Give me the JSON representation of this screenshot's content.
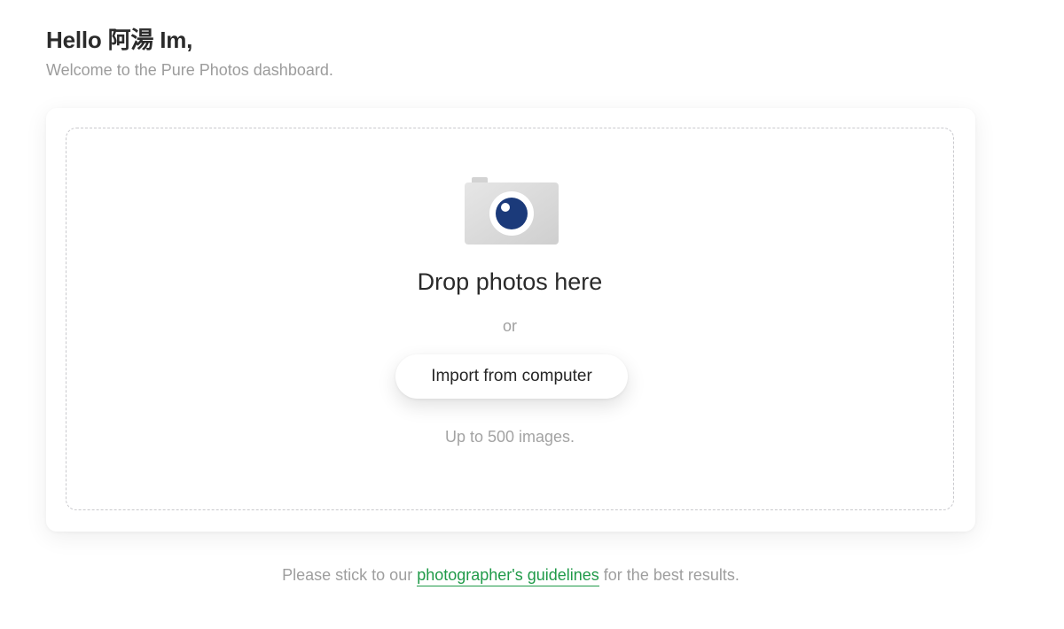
{
  "header": {
    "greeting": "Hello 阿湯 Im,",
    "subtitle": "Welcome to the Pure Photos dashboard."
  },
  "upload": {
    "icon": "camera-icon",
    "title": "Drop photos here",
    "or_text": "or",
    "import_button_label": "Import from computer",
    "limit_text": "Up to 500 images."
  },
  "footer": {
    "prefix": "Please stick to our ",
    "link_text": "photographer's guidelines",
    "suffix": " for the best results."
  },
  "colors": {
    "link": "#1f9a48",
    "camera_lens": "#1b3a7a",
    "camera_body": "#d9d9d9"
  }
}
